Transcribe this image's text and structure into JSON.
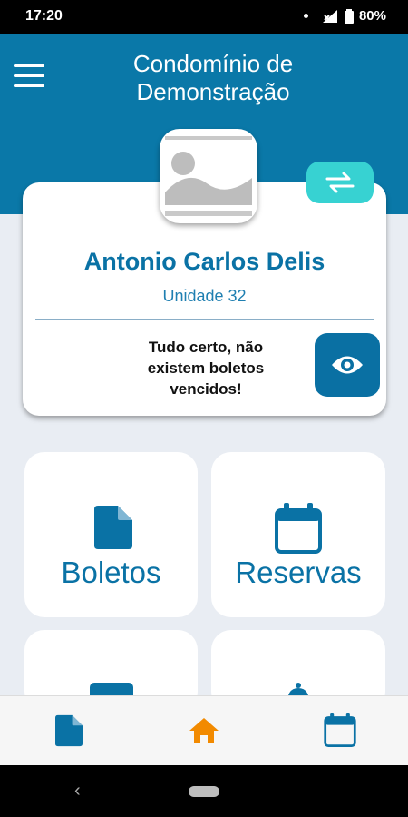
{
  "status_bar": {
    "time": "17:20",
    "battery": "80%"
  },
  "header": {
    "title_line1": "Condomínio de",
    "title_line2": "Demonstração"
  },
  "profile": {
    "name": "Antonio Carlos Delis",
    "unit": "Unidade 32",
    "message_line1": "Tudo certo, não",
    "message_line2": "existem boletos",
    "message_line3": "vencidos!"
  },
  "tiles": [
    {
      "label": "Boletos",
      "icon": "document-icon"
    },
    {
      "label": "Reservas",
      "icon": "calendar-icon"
    }
  ],
  "bottom_nav": [
    {
      "icon": "document-icon"
    },
    {
      "icon": "home-icon"
    },
    {
      "icon": "calendar-icon"
    }
  ],
  "colors": {
    "primary": "#0a78a8",
    "accent_teal": "#37d2d2",
    "active_nav": "#f28a00",
    "background": "#e9edf3"
  }
}
